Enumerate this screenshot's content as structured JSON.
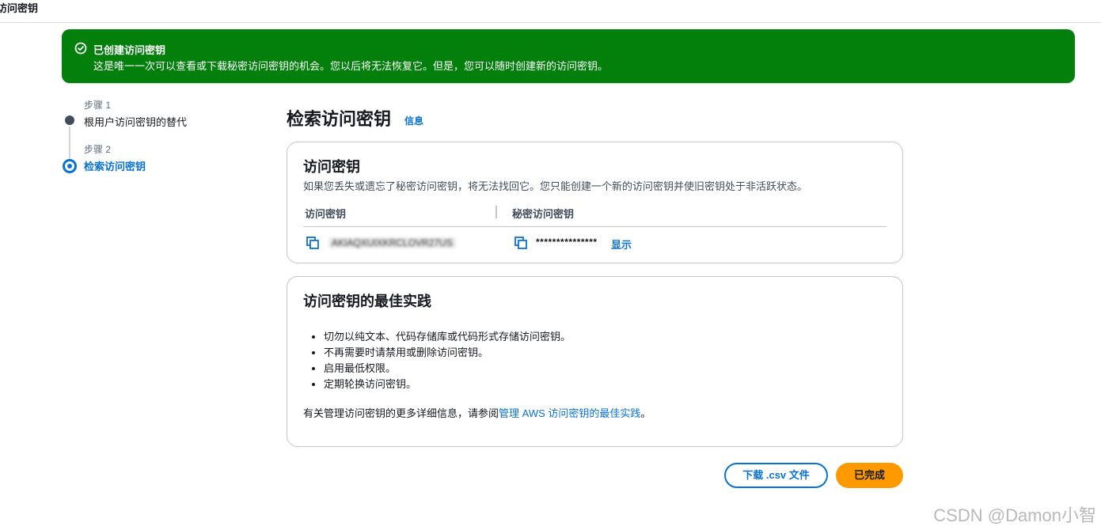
{
  "header": {
    "breadcrumb": "访问密钥"
  },
  "flash": {
    "title": "已创建访问密钥",
    "message": "这是唯一一次可以查看或下载秘密访问密钥的机会。您以后将无法恢复它。但是，您可以随时创建新的访问密钥。",
    "color": "#037f0c"
  },
  "steps": [
    {
      "num": "步骤 1",
      "label": "根用户访问密钥的替代",
      "state": "completed"
    },
    {
      "num": "步骤 2",
      "label": "检索访问密钥",
      "state": "active"
    }
  ],
  "page": {
    "title": "检索访问密钥",
    "info_link": "信息"
  },
  "access_key_card": {
    "title": "访问密钥",
    "description": "如果您丢失或遗忘了秘密访问密钥，将无法找回它。您只能创建一个新的访问密钥并使旧密钥处于非活跃状态。",
    "columns": {
      "access_key": "访问密钥",
      "secret_key": "秘密访问密钥"
    },
    "access_key_value": "AKIAQXUIXKRCLOVR27US",
    "secret_value": "***************",
    "show_link": "显示"
  },
  "best_practices": {
    "title": "访问密钥的最佳实践",
    "items": [
      "切勿以纯文本、代码存储库或代码形式存储访问密钥。",
      "不再需要时请禁用或删除访问密钥。",
      "启用最低权限。",
      "定期轮换访问密钥。"
    ],
    "more_prefix": "有关管理访问密钥的更多详细信息，请参阅",
    "more_link": "管理 AWS 访问密钥的最佳实践",
    "more_suffix": "。"
  },
  "actions": {
    "download": "下载 .csv 文件",
    "done": "已完成"
  },
  "watermark": "CSDN @Damon小智",
  "colors": {
    "accent": "#0972d3",
    "primary_button": "#ff9900",
    "success": "#037f0c"
  }
}
